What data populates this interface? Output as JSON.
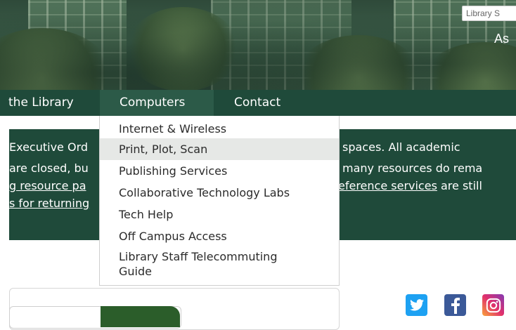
{
  "header": {
    "search_label": "Library S",
    "ask_label": "As"
  },
  "nav": {
    "items": [
      {
        "label": "the Library"
      },
      {
        "label": "Computers"
      },
      {
        "label": "Contact"
      }
    ]
  },
  "dropdown": {
    "items": [
      {
        "label": "Internet & Wireless"
      },
      {
        "label": "Print, Plot, Scan"
      },
      {
        "label": "Publishing Services"
      },
      {
        "label": "Collaborative Technology Labs"
      },
      {
        "label": "Tech Help"
      },
      {
        "label": "Off Campus Access"
      },
      {
        "label": "Library Staff Telecommuting"
      },
      {
        "label": "Guide"
      }
    ]
  },
  "notice": {
    "line1_left": "Executive Ord",
    "line1_right": "spaces. All academic",
    "line2_left": "are closed, bu",
    "line2_right": "many resources do rema",
    "line3_left_link": "g resource pa",
    "line3_right_link": "eference services",
    "line3_right_text": " are still",
    "line4_left_link": "s for returning"
  },
  "social": {
    "icons": [
      "twitter-icon",
      "facebook-icon",
      "instagram-icon"
    ]
  },
  "colors": {
    "nav_bg": "#1f4a3a",
    "nav_active_bg": "#2c5a48",
    "notice_bg": "#1f4a3a",
    "menu_hover_bg": "#e6e8e6"
  }
}
